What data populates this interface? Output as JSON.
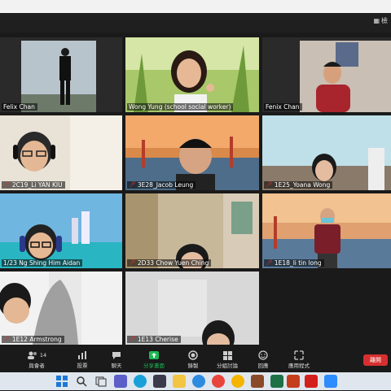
{
  "header": {
    "view_label": "檢"
  },
  "participants": [
    {
      "name": "Felix Chan",
      "muted": false
    },
    {
      "name": "Wong Yung (school social worker)",
      "muted": false
    },
    {
      "name": "Fenix Chan",
      "muted": false
    },
    {
      "name": "2C19_Li YAN KIU",
      "muted": true
    },
    {
      "name": "3E28_Jacob Leung",
      "muted": true
    },
    {
      "name": "1E25_Yoana Wong",
      "muted": true
    },
    {
      "name": "1/23 Ng Shing Him Aidan",
      "muted": false
    },
    {
      "name": "2D33 Chow Yuen Ching",
      "muted": true
    },
    {
      "name": "1E18_li tin long",
      "muted": true
    },
    {
      "name": "1E12 Armstrong",
      "muted": true
    },
    {
      "name": "1E13 Cherise",
      "muted": true
    }
  ],
  "toolbar": {
    "participants_label": "與會者",
    "participants_count": "14",
    "polls_label": "投票",
    "chat_label": "聊天",
    "share_label": "分享畫面",
    "record_label": "錄製",
    "breakout_label": "分組討論",
    "reactions_label": "回應",
    "apps_label": "應用程式",
    "leave_label": "離開"
  },
  "icons": {
    "participants": "people-icon",
    "polls": "bar-chart-icon",
    "chat": "chat-bubble-icon",
    "share": "share-screen-icon",
    "record": "record-icon",
    "breakout": "grid-icon",
    "reactions": "emoji-icon",
    "apps": "apps-icon"
  },
  "colors": {
    "active_speaker": "#c8e634",
    "leave": "#d62f2f",
    "share": "#1db954"
  }
}
